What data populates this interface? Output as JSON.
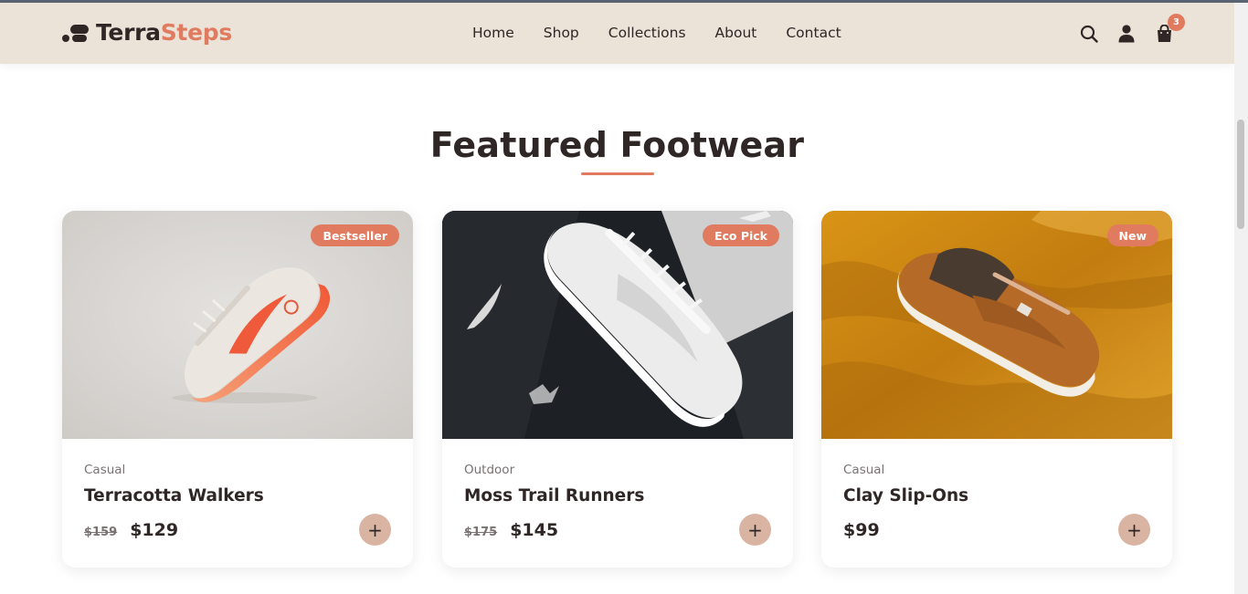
{
  "brand": {
    "name_part1": "Terra",
    "name_part2": "Steps",
    "accent": "#e07b5f",
    "dark": "#2f2626",
    "header_bg": "#ebe2d8"
  },
  "nav": {
    "items": [
      "Home",
      "Shop",
      "Collections",
      "About",
      "Contact"
    ]
  },
  "header_icons": {
    "search": "search-icon",
    "account": "user-icon",
    "cart": "shopping-bag-icon",
    "cart_count": "3"
  },
  "section": {
    "title": "Featured Footwear"
  },
  "products": [
    {
      "tag": "Bestseller",
      "category": "Casual",
      "name": "Terracotta Walkers",
      "old_price": "$159",
      "price": "$129",
      "add_label": "+",
      "image": "white-and-orange-sneaker-on-grey"
    },
    {
      "tag": "Eco Pick",
      "category": "Outdoor",
      "name": "Moss Trail Runners",
      "old_price": "$175",
      "price": "$145",
      "add_label": "+",
      "image": "white-sneaker-on-black-fabric"
    },
    {
      "tag": "New",
      "category": "Casual",
      "name": "Clay Slip-Ons",
      "old_price": "",
      "price": "$99",
      "add_label": "+",
      "image": "brown-sneaker-on-mustard-fabric"
    }
  ]
}
